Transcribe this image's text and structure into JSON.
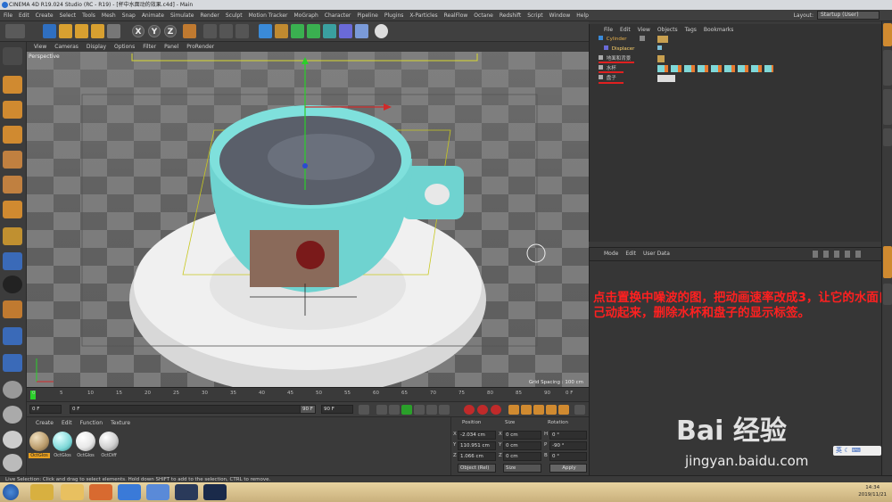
{
  "window": {
    "title": "CINEMA 4D R19.024 Studio (RC - R19) - [杯中水面动的效果.c4d] - Main"
  },
  "menubar": {
    "items": [
      "File",
      "Edit",
      "Create",
      "Select",
      "Tools",
      "Mesh",
      "Snap",
      "Animate",
      "Simulate",
      "Render",
      "Sculpt",
      "Motion Tracker",
      "MoGraph",
      "Character",
      "Pipeline",
      "Plugins",
      "X-Particles",
      "RealFlow",
      "Octane",
      "Redshift",
      "Script",
      "Window",
      "Help"
    ],
    "layout_label": "Layout:",
    "layout_value": "Startup (User)"
  },
  "toolbar": {
    "axis_x": "X",
    "axis_y": "Y",
    "axis_z": "Z"
  },
  "viewport": {
    "menu": [
      "View",
      "Cameras",
      "Display",
      "Options",
      "Filter",
      "Panel",
      "ProRender"
    ],
    "label": "Perspective",
    "grid_spacing": "Grid Spacing : 100 cm"
  },
  "timeline": {
    "ticks": [
      "0",
      "5",
      "10",
      "15",
      "20",
      "25",
      "30",
      "35",
      "40",
      "45",
      "50",
      "55",
      "60",
      "65",
      "70",
      "75",
      "80",
      "85",
      "90"
    ],
    "end_frame": "0 F"
  },
  "transport": {
    "current": "0 F",
    "start": "0 F",
    "end": "90 F",
    "max": "90 F"
  },
  "materials": {
    "menu": [
      "Create",
      "Edit",
      "Function",
      "Texture"
    ],
    "items": [
      {
        "label": "OctGlos",
        "color": "#b89a6a"
      },
      {
        "label": "OctGlos",
        "color": "#7fd8d8"
      },
      {
        "label": "OctGlos",
        "color": "#e8e8e8"
      },
      {
        "label": "OctDiff",
        "color": "#d0d0d0"
      }
    ]
  },
  "coords": {
    "headers": [
      "Position",
      "Size",
      "Rotation"
    ],
    "rows": [
      {
        "axis": "X",
        "pos": "-2.034 cm",
        "size_axis": "X",
        "size": "0 cm",
        "rot_axis": "H",
        "rot": "0 °"
      },
      {
        "axis": "Y",
        "pos": "110.951 cm",
        "size_axis": "Y",
        "size": "0 cm",
        "rot_axis": "P",
        "rot": "-90 °"
      },
      {
        "axis": "Z",
        "pos": "1.066 cm",
        "size_axis": "Z",
        "size": "0 cm",
        "rot_axis": "B",
        "rot": "0 °"
      }
    ],
    "mode": "Object (Rel)",
    "size_mode": "Size",
    "apply": "Apply"
  },
  "object_manager": {
    "menu": [
      "File",
      "Edit",
      "View",
      "Objects",
      "Tags",
      "Bookmarks"
    ],
    "objects": [
      {
        "name": "Cylinder",
        "color": "#e8b04a"
      },
      {
        "name": "Displacer",
        "color": "#ffd36a"
      },
      {
        "name": "地面和背景",
        "color": "#cfcfcf"
      },
      {
        "name": "水杯",
        "color": "#cfcfcf"
      },
      {
        "name": "盘子",
        "color": "#cfcfcf"
      }
    ]
  },
  "attribute_manager": {
    "menu": [
      "Mode",
      "Edit",
      "User Data"
    ],
    "annotation": "点击置换中噪波的图，把动画速率改成3，让它的水面自己动起来，删除水杯和盘子的显示标签。"
  },
  "statusbar": {
    "text": "Live Selection: Click and drag to select elements. Hold down SHIFT to add to the selection, CTRL to remove."
  },
  "taskbar": {
    "time": "14:34",
    "date": "2019/11/21"
  },
  "watermark": {
    "brand": "Bai 经验",
    "url": "jingyan.baidu.com"
  },
  "ime": {
    "text": "英 ☾ ⌨"
  }
}
